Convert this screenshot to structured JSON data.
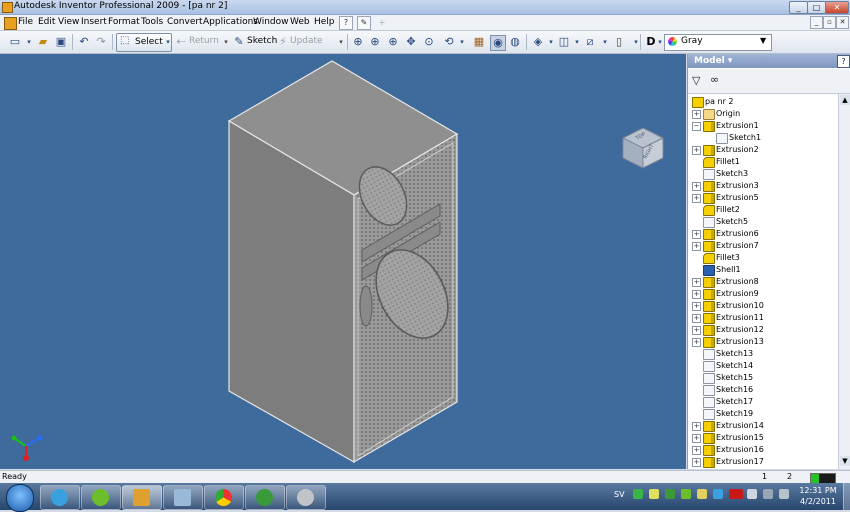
{
  "window": {
    "title": "Autodesk Inventor Professional 2009 - [pa nr 2]",
    "controls": [
      "_",
      "□",
      "✕"
    ]
  },
  "menubar": {
    "items": [
      "File",
      "Edit",
      "View",
      "Insert",
      "Format",
      "Tools",
      "Convert",
      "Applications",
      "Window",
      "Web",
      "Help"
    ],
    "mdi_controls": [
      "_",
      "▫",
      "✕"
    ]
  },
  "toolbar": {
    "select_label": "Select",
    "return_label": "Return",
    "sketch_label": "Sketch",
    "update_label": "Update",
    "color_value": "Gray"
  },
  "browser": {
    "title": "Model ▾",
    "filter_icon": "funnel-icon",
    "find_icon": "binoculars-icon",
    "root": "pa nr 2",
    "nodes": [
      {
        "label": "Origin",
        "type": "origin",
        "expander": "+",
        "level": 1
      },
      {
        "label": "Extrusion1",
        "type": "extrusion",
        "expander": "−",
        "level": 1
      },
      {
        "label": "Sketch1",
        "type": "sketch",
        "expander": "",
        "level": 2
      },
      {
        "label": "Extrusion2",
        "type": "extrusion",
        "expander": "+",
        "level": 1
      },
      {
        "label": "Fillet1",
        "type": "fillet",
        "expander": "",
        "level": 1
      },
      {
        "label": "Sketch3",
        "type": "sketch",
        "expander": "",
        "level": 1
      },
      {
        "label": "Extrusion3",
        "type": "extrusion",
        "expander": "+",
        "level": 1
      },
      {
        "label": "Extrusion5",
        "type": "extrusion",
        "expander": "+",
        "level": 1
      },
      {
        "label": "Fillet2",
        "type": "fillet",
        "expander": "",
        "level": 1
      },
      {
        "label": "Sketch5",
        "type": "sketch",
        "expander": "",
        "level": 1
      },
      {
        "label": "Extrusion6",
        "type": "extrusion",
        "expander": "+",
        "level": 1
      },
      {
        "label": "Extrusion7",
        "type": "extrusion",
        "expander": "+",
        "level": 1
      },
      {
        "label": "Fillet3",
        "type": "fillet",
        "expander": "",
        "level": 1
      },
      {
        "label": "Shell1",
        "type": "shell",
        "expander": "",
        "level": 1
      },
      {
        "label": "Extrusion8",
        "type": "extrusion",
        "expander": "+",
        "level": 1
      },
      {
        "label": "Extrusion9",
        "type": "extrusion",
        "expander": "+",
        "level": 1
      },
      {
        "label": "Extrusion10",
        "type": "extrusion",
        "expander": "+",
        "level": 1
      },
      {
        "label": "Extrusion11",
        "type": "extrusion",
        "expander": "+",
        "level": 1
      },
      {
        "label": "Extrusion12",
        "type": "extrusion",
        "expander": "+",
        "level": 1
      },
      {
        "label": "Extrusion13",
        "type": "extrusion",
        "expander": "+",
        "level": 1
      },
      {
        "label": "Sketch13",
        "type": "sketch",
        "expander": "",
        "level": 1
      },
      {
        "label": "Sketch14",
        "type": "sketch",
        "expander": "",
        "level": 1
      },
      {
        "label": "Sketch15",
        "type": "sketch",
        "expander": "",
        "level": 1
      },
      {
        "label": "Sketch16",
        "type": "sketch",
        "expander": "",
        "level": 1
      },
      {
        "label": "Sketch17",
        "type": "sketch",
        "expander": "",
        "level": 1
      },
      {
        "label": "Sketch19",
        "type": "sketch",
        "expander": "",
        "level": 1
      },
      {
        "label": "Extrusion14",
        "type": "extrusion",
        "expander": "+",
        "level": 1
      },
      {
        "label": "Extrusion15",
        "type": "extrusion",
        "expander": "+",
        "level": 1
      },
      {
        "label": "Extrusion16",
        "type": "extrusion",
        "expander": "+",
        "level": 1
      },
      {
        "label": "Extrusion17",
        "type": "extrusion",
        "expander": "+",
        "level": 1
      }
    ]
  },
  "viewcube": {
    "face_top": "TOP",
    "face_right": "RIGHT"
  },
  "statusbar": {
    "status": "Ready",
    "count1": "1",
    "count2": "2"
  },
  "taskbar": {
    "apps": [
      "windows-live-messenger",
      "spotify",
      "autodesk-inventor",
      "calculator",
      "google-chrome",
      "utorrent",
      "media-player"
    ],
    "language": "SV",
    "time": "12:31 PM",
    "date": "4/2/2011"
  },
  "colors": {
    "viewport_bg": "#3e6a9c",
    "model_gray": "#8e8e8e",
    "accent": "#7f97c0"
  }
}
